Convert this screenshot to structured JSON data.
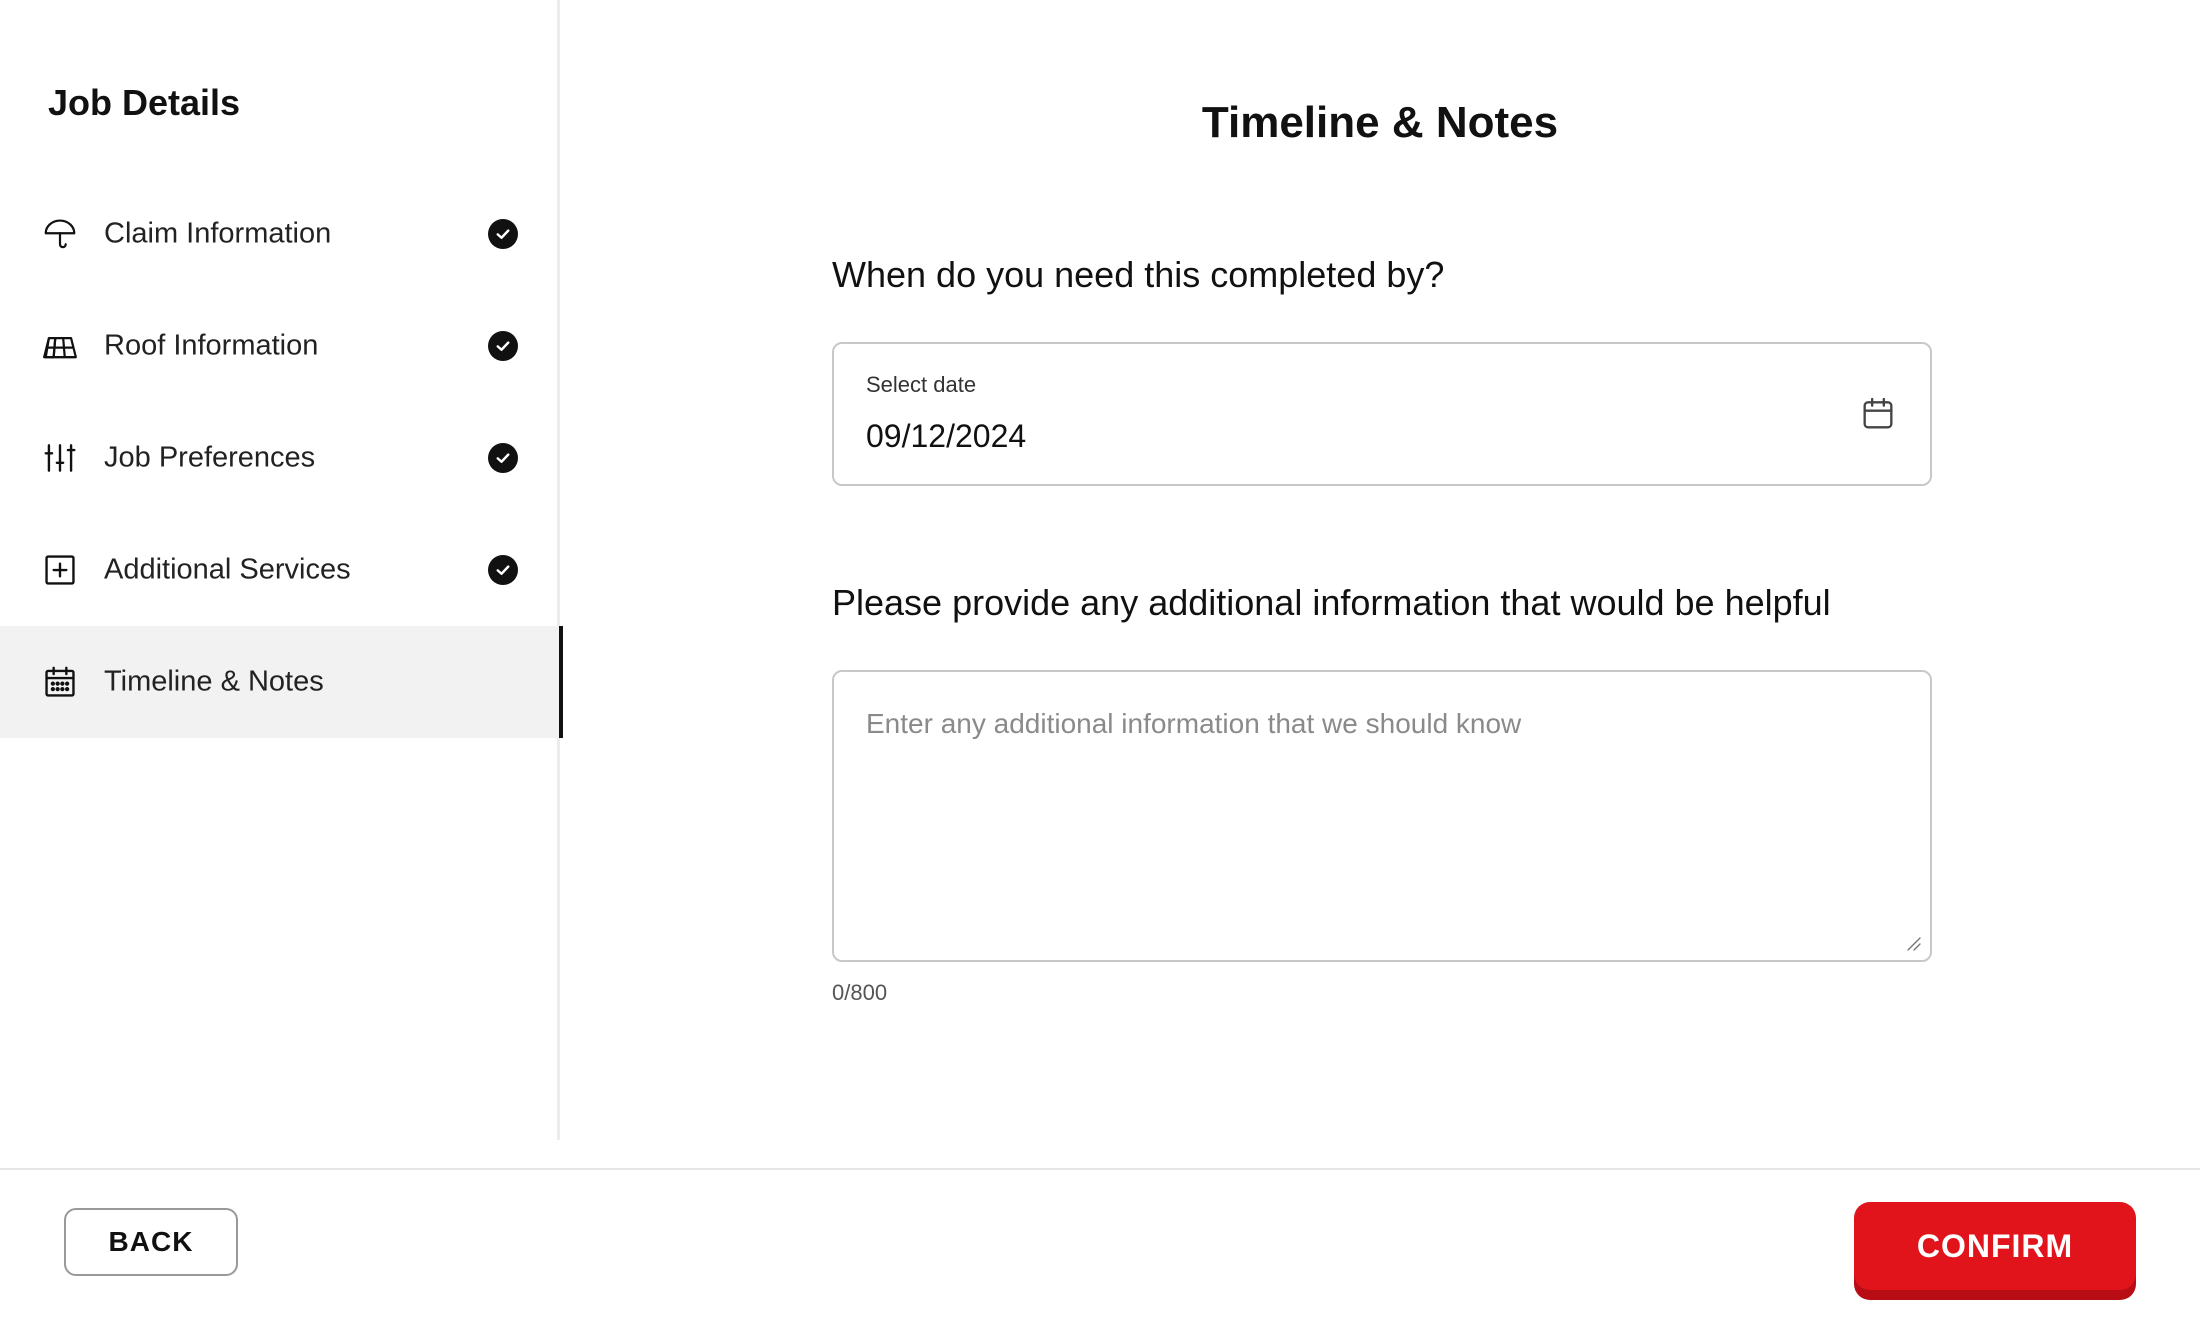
{
  "sidebar": {
    "title": "Job Details",
    "items": [
      {
        "label": "Claim Information",
        "icon": "umbrella-icon",
        "completed": true,
        "active": false
      },
      {
        "label": "Roof Information",
        "icon": "roof-icon",
        "completed": true,
        "active": false
      },
      {
        "label": "Job Preferences",
        "icon": "sliders-icon",
        "completed": true,
        "active": false
      },
      {
        "label": "Additional Services",
        "icon": "plus-square-icon",
        "completed": true,
        "active": false
      },
      {
        "label": "Timeline & Notes",
        "icon": "calendar-icon",
        "completed": false,
        "active": true
      }
    ]
  },
  "main": {
    "title": "Timeline & Notes",
    "date_question": "When do you need this completed by?",
    "date_field": {
      "label": "Select date",
      "value": "09/12/2024",
      "icon": "calendar-icon"
    },
    "notes_question": "Please provide any additional information that would be helpful",
    "notes_field": {
      "placeholder": "Enter any additional information that we should know",
      "value": "",
      "char_count": "0/800"
    }
  },
  "footer": {
    "back_label": "BACK",
    "confirm_label": "CONFIRM"
  },
  "colors": {
    "accent": "#e1141c",
    "accent_shadow": "#b80d14",
    "active_nav_bg": "#f2f2f2",
    "text": "#111111",
    "border": "#c8c8c8"
  }
}
